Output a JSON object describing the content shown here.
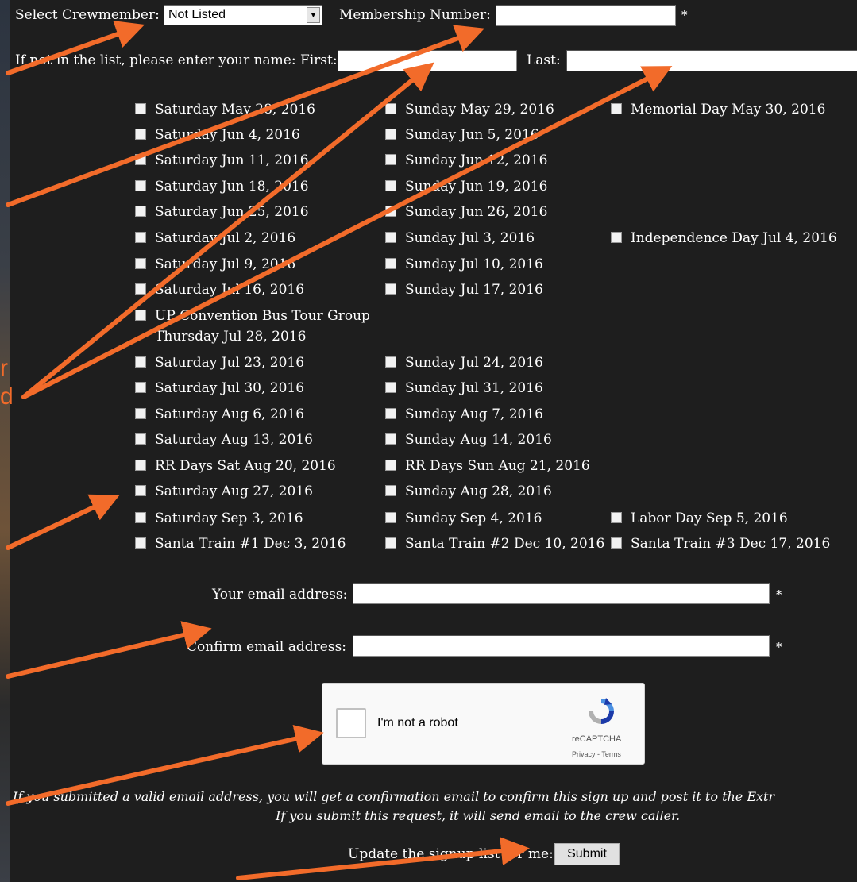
{
  "form": {
    "crewmember_label": "Select Crewmember:",
    "crewmember_value": "Not Listed",
    "membership_label": "Membership Number:",
    "name_prompt": "If not in the list, please enter your name: First:",
    "last_label": "Last:",
    "required_mark": "*",
    "email_label": "Your email address:",
    "confirm_email_label": "Confirm email address:",
    "note_line1": "If you submitted a valid email address, you will get a confirmation email to confirm this sign up and post it to the Extr",
    "note_line2": "If you submit this request, it will send email to the crew caller.",
    "update_label": "Update the signup list for me:",
    "submit_label": "Submit"
  },
  "dates": [
    {
      "label": "Saturday May 28, 2016"
    },
    {
      "label": "Sunday May 29, 2016"
    },
    {
      "label": "Memorial Day May 30, 2016"
    },
    {
      "label": "Saturday Jun 4, 2016"
    },
    {
      "label": "Sunday Jun 5, 2016"
    },
    {
      "label": "Saturday Jun 11, 2016"
    },
    {
      "label": "Sunday Jun 12, 2016"
    },
    {
      "label": "Saturday Jun 18, 2016"
    },
    {
      "label": "Sunday Jun 19, 2016"
    },
    {
      "label": "Saturday Jun 25, 2016"
    },
    {
      "label": "Sunday Jun 26, 2016"
    },
    {
      "label": "Saturday Jul 2, 2016"
    },
    {
      "label": "Sunday Jul 3, 2016"
    },
    {
      "label": "Independence Day Jul 4, 2016"
    },
    {
      "label": "Saturday Jul 9, 2016"
    },
    {
      "label": "Sunday Jul 10, 2016"
    },
    {
      "label": "Saturday Jul 16, 2016"
    },
    {
      "label": "Sunday Jul 17, 2016"
    },
    {
      "label": "UP Convention Bus Tour Group"
    },
    {
      "label": "Thursday Jul 28, 2016"
    },
    {
      "label": "Saturday Jul 23, 2016"
    },
    {
      "label": "Sunday Jul 24, 2016"
    },
    {
      "label": "Saturday Jul 30, 2016"
    },
    {
      "label": "Sunday Jul 31, 2016"
    },
    {
      "label": "Saturday Aug 6, 2016"
    },
    {
      "label": "Sunday Aug 7, 2016"
    },
    {
      "label": "Saturday Aug 13, 2016"
    },
    {
      "label": "Sunday Aug 14, 2016"
    },
    {
      "label": "RR Days Sat Aug 20, 2016"
    },
    {
      "label": "RR Days Sun Aug 21, 2016"
    },
    {
      "label": "Saturday Aug 27, 2016"
    },
    {
      "label": "Sunday Aug 28, 2016"
    },
    {
      "label": "Saturday Sep 3, 2016"
    },
    {
      "label": "Sunday Sep 4, 2016"
    },
    {
      "label": "Labor Day Sep 5, 2016"
    },
    {
      "label": "Santa Train #1 Dec 3, 2016"
    },
    {
      "label": "Santa Train #2 Dec 10, 2016"
    },
    {
      "label": "Santa Train #3 Dec 17, 2016"
    }
  ],
  "captcha": {
    "label": "I'm not a robot",
    "brand": "reCAPTCHA",
    "links": "Privacy - Terms"
  },
  "sidebar_fragments": {
    "text1": "r",
    "text2": "d"
  },
  "colors": {
    "background": "#1e1e1e",
    "annotation_arrow": "#f26b2a"
  }
}
